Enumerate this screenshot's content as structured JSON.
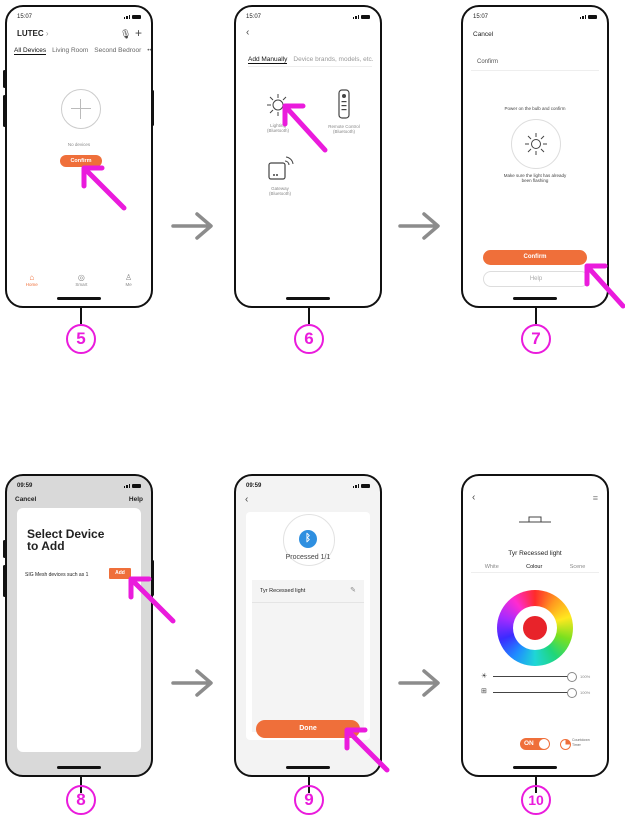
{
  "screens": {
    "s5": {
      "time": "15:07",
      "brand": "LUTEC",
      "brand_chevron": "›",
      "tabs": [
        "All Devices",
        "Living Room",
        "Second Bedroor"
      ],
      "more": "•••",
      "empty_text": "No devices",
      "confirm_label": "Confirm",
      "nav": [
        "Home",
        "Smart",
        "Me"
      ],
      "step": "5"
    },
    "s6": {
      "time": "15:07",
      "tab_manual": "Add Manually",
      "search_placeholder": "Device brands, models, etc.",
      "items": [
        {
          "name": "Lighting",
          "sub": "(Bluetooth)"
        },
        {
          "name": "Remote Control",
          "sub": "(Bluetooth)"
        },
        {
          "name": "Gateway",
          "sub": "(Bluetooth)"
        }
      ],
      "step": "6"
    },
    "s7": {
      "time": "15:07",
      "cancel": "Cancel",
      "title": "Confirm",
      "instruction": "Power on the bulb and confirm",
      "note": "Make sure the light has already been flashing",
      "confirm_label": "Confirm",
      "help_label": "Help",
      "step": "7"
    },
    "s8": {
      "time": "09:59",
      "cancel": "Cancel",
      "help": "Help",
      "title": "Select Device to Add",
      "device_text": "SIG Mesh devices such as 1",
      "add_label": "Add",
      "step": "8"
    },
    "s9": {
      "time": "09:59",
      "processed": "Processed 1/1",
      "device_name": "Tyr Recessed light",
      "done_label": "Done",
      "step": "9"
    },
    "s10": {
      "device_name": "Tyr Recessed light",
      "tabs": [
        "White",
        "Colour",
        "Scene"
      ],
      "brightness": "100%",
      "saturation": "100%",
      "on_label": "ON",
      "countdown_label": "Countdown Timer",
      "step": "10"
    }
  },
  "colors": {
    "accent": "#ef6f3a",
    "callout": "#ea1bdc",
    "arrow": "#8c8c8c",
    "bluetooth": "#2e8fe0"
  }
}
